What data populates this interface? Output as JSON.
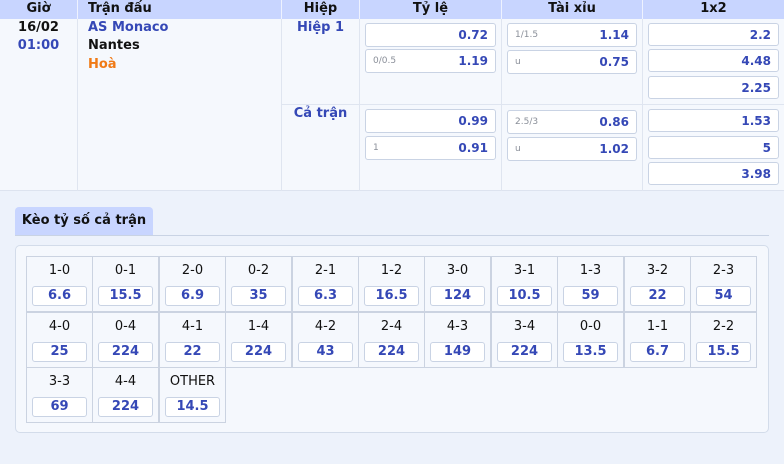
{
  "header": {
    "columns": [
      "Giờ",
      "Trận đấu",
      "Hiệp",
      "Tỷ lệ",
      "Tài xỉu",
      "1x2"
    ]
  },
  "match": {
    "date": "16/02",
    "time": "01:00",
    "home": "AS Monaco",
    "away": "Nantes",
    "draw": "Hoà",
    "periods": [
      {
        "name": "Hiệp 1",
        "handicap": [
          {
            "line": "",
            "value": "0.72"
          },
          {
            "line": "0/0.5",
            "value": "1.19"
          }
        ],
        "overunder": [
          {
            "line": "1/1.5",
            "value": "1.14"
          },
          {
            "line": "u",
            "value": "0.75"
          }
        ],
        "x12": [
          "2.2",
          "4.48",
          "2.25"
        ]
      },
      {
        "name": "Cả trận",
        "handicap": [
          {
            "line": "",
            "value": "0.99"
          },
          {
            "line": "1",
            "value": "0.91"
          }
        ],
        "overunder": [
          {
            "line": "2.5/3",
            "value": "0.86"
          },
          {
            "line": "u",
            "value": "1.02"
          }
        ],
        "x12": [
          "1.53",
          "5",
          "3.98"
        ]
      }
    ]
  },
  "correct_score": {
    "tab_label": "Kèo tỷ số cả trận",
    "items": [
      {
        "score": "1-0",
        "odds": "6.6"
      },
      {
        "score": "0-1",
        "odds": "15.5"
      },
      {
        "score": "2-0",
        "odds": "6.9"
      },
      {
        "score": "0-2",
        "odds": "35"
      },
      {
        "score": "2-1",
        "odds": "6.3"
      },
      {
        "score": "1-2",
        "odds": "16.5"
      },
      {
        "score": "3-0",
        "odds": "124"
      },
      {
        "score": "3-1",
        "odds": "10.5"
      },
      {
        "score": "1-3",
        "odds": "59"
      },
      {
        "score": "3-2",
        "odds": "22"
      },
      {
        "score": "2-3",
        "odds": "54"
      },
      {
        "score": "4-0",
        "odds": "25"
      },
      {
        "score": "0-4",
        "odds": "224"
      },
      {
        "score": "4-1",
        "odds": "22"
      },
      {
        "score": "1-4",
        "odds": "224"
      },
      {
        "score": "4-2",
        "odds": "43"
      },
      {
        "score": "2-4",
        "odds": "224"
      },
      {
        "score": "4-3",
        "odds": "149"
      },
      {
        "score": "3-4",
        "odds": "224"
      },
      {
        "score": "0-0",
        "odds": "13.5"
      },
      {
        "score": "1-1",
        "odds": "6.7"
      },
      {
        "score": "2-2",
        "odds": "15.5"
      },
      {
        "score": "3-3",
        "odds": "69"
      },
      {
        "score": "4-4",
        "odds": "224"
      },
      {
        "score": "OTHER",
        "odds": "14.5"
      }
    ]
  },
  "colors": {
    "header_bg": "#c8d5ff",
    "odds_text": "#3548b6",
    "home_team": "#3548b6",
    "draw_text": "#f07a16",
    "time_text": "#3548b6"
  }
}
